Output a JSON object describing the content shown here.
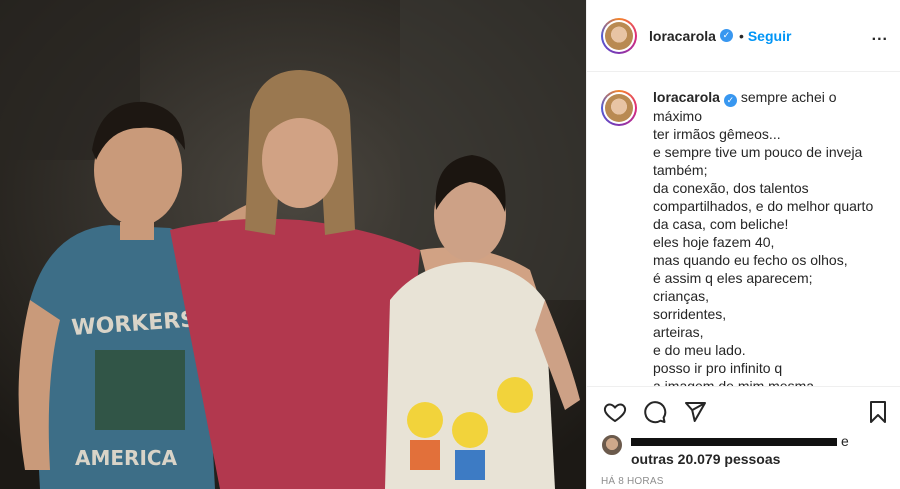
{
  "post": {
    "username": "loracarola",
    "follow_label": "Seguir",
    "dot": "•",
    "more_label": "...",
    "verified_mark": "✓",
    "caption_lines": [
      "sempre achei o máximo",
      "ter irmãos gêmeos...",
      "e sempre tive um pouco de inveja",
      "também;",
      "da conexão, dos talentos",
      "compartilhados, e do melhor quarto",
      "da casa, com beliche!",
      "eles hoje fazem 40,",
      "mas quando eu fecho os olhos,",
      "é assim q eles aparecem;",
      "crianças,",
      "sorridentes,",
      "arteiras,",
      "e do meu lado.",
      "posso ir pro infinito q",
      "a imagem de mim mesma permanece"
    ],
    "likes_suffix": "e",
    "likes_others": "outras 20.079 pessoas",
    "timestamp": "HÁ 8 HORAS",
    "shirt_text_top": "WORKERS OF",
    "shirt_text_bottom": "AMERICA"
  },
  "icons": {
    "like": "heart-icon",
    "comment": "comment-icon",
    "share": "paper-plane-icon",
    "save": "bookmark-icon"
  },
  "colors": {
    "link_blue": "#0095f6",
    "verified_blue": "#3897f0",
    "text": "#262626",
    "muted": "#8e8e8e"
  }
}
